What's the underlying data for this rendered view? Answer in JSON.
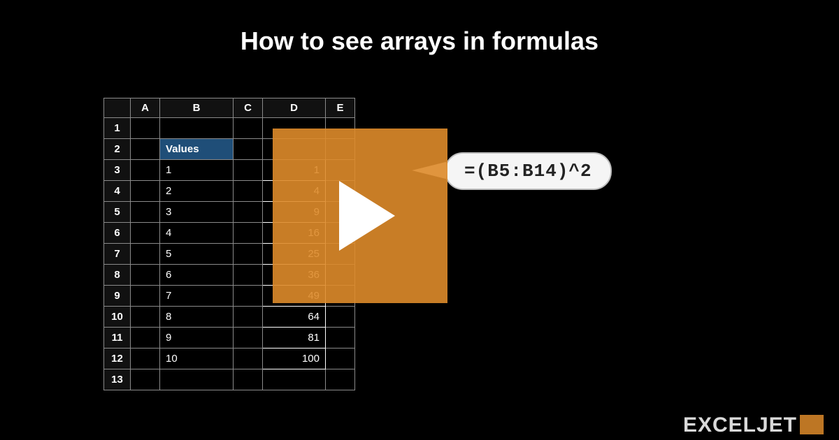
{
  "title": "How to see arrays in formulas",
  "columns": [
    "A",
    "B",
    "C",
    "D",
    "E"
  ],
  "rowNumbers": [
    "1",
    "2",
    "3",
    "4",
    "5",
    "6",
    "7",
    "8",
    "9",
    "10",
    "11",
    "12",
    "13"
  ],
  "header_cell": "Values",
  "values_b": [
    "1",
    "2",
    "3",
    "4",
    "5",
    "6",
    "7",
    "8",
    "9",
    "10"
  ],
  "values_d": [
    "1",
    "4",
    "9",
    "16",
    "25",
    "36",
    "49",
    "64",
    "81",
    "100"
  ],
  "formula_callout": "=(B5:B14)^2",
  "brand": "EXCELJET"
}
